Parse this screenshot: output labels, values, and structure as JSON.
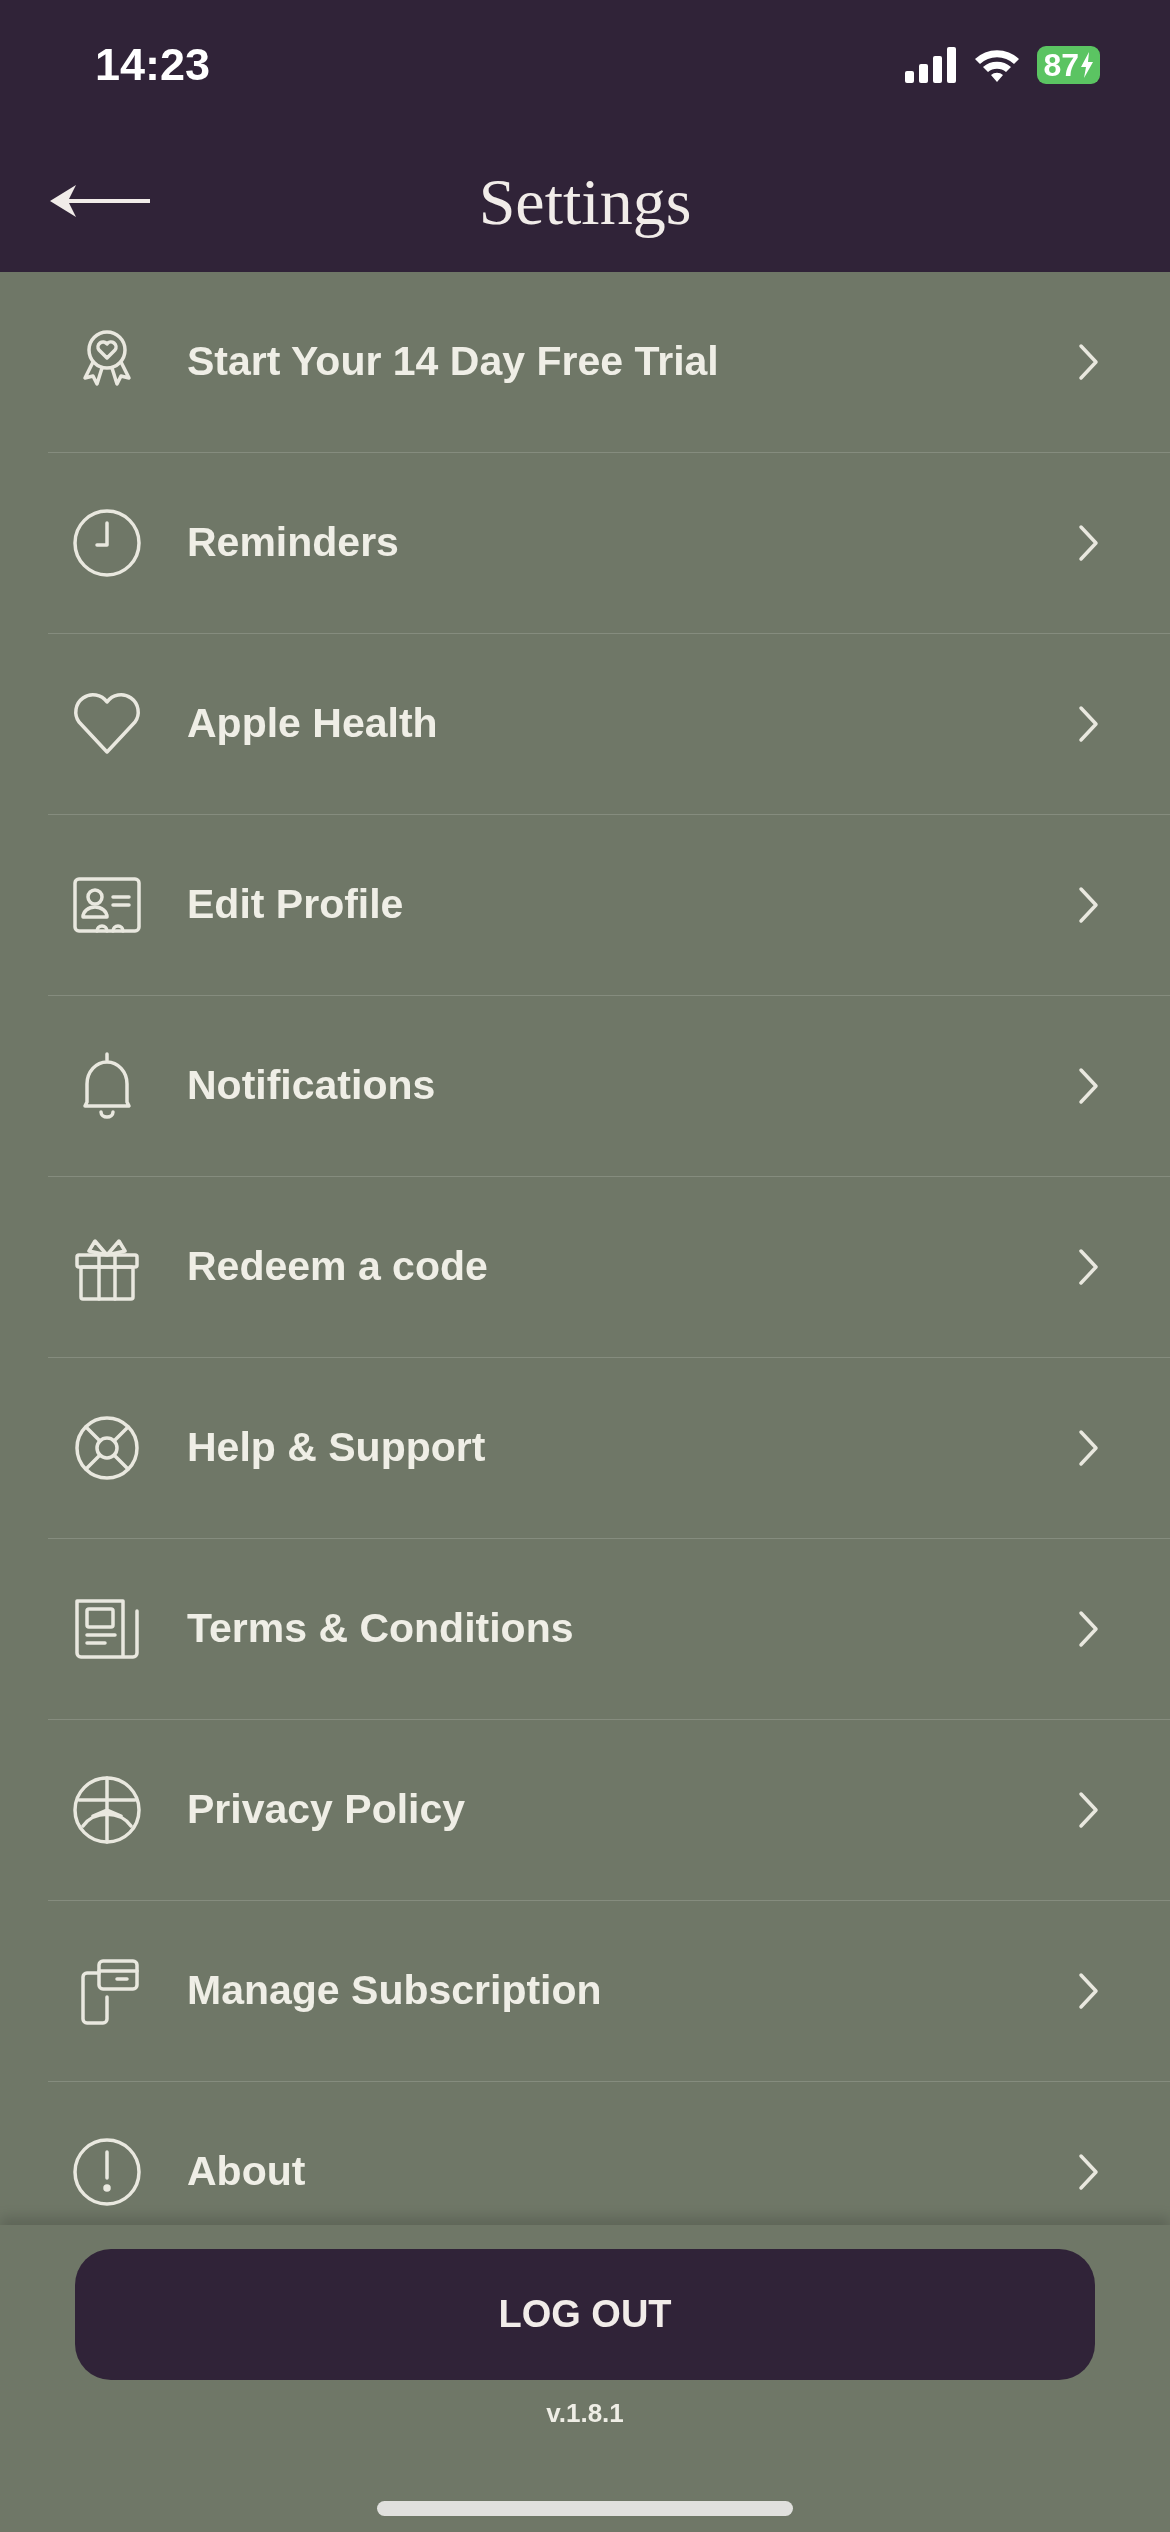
{
  "status_bar": {
    "time": "14:23",
    "battery": "87"
  },
  "header": {
    "title": "Settings"
  },
  "items": [
    {
      "label": "Start Your 14 Day Free Trial"
    },
    {
      "label": "Reminders"
    },
    {
      "label": "Apple Health"
    },
    {
      "label": "Edit Profile"
    },
    {
      "label": "Notifications"
    },
    {
      "label": "Redeem a code"
    },
    {
      "label": "Help & Support"
    },
    {
      "label": "Terms & Conditions"
    },
    {
      "label": "Privacy Policy"
    },
    {
      "label": "Manage Subscription"
    },
    {
      "label": "About"
    }
  ],
  "logout_button": "LOG OUT",
  "version": "v.1.8.1"
}
